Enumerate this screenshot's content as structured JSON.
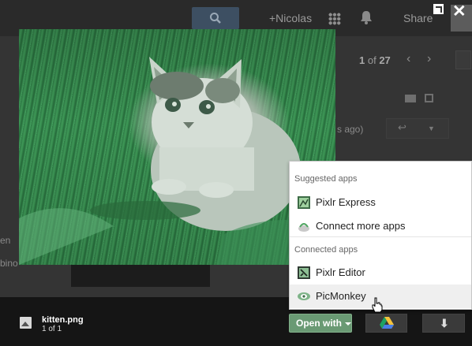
{
  "header": {
    "user_name": "+Nicolas",
    "share_label": "Share"
  },
  "pager": {
    "current": "1",
    "of_label": "of",
    "total": "27"
  },
  "message": {
    "time_fragment": "s ago)"
  },
  "sidebar_fragments": [
    "en",
    "bino"
  ],
  "viewer": {
    "close_glyph": "✕",
    "file_name": "kitten.png",
    "file_count": "1 of 1",
    "open_with_label": "Open with",
    "download_glyph": "⬇"
  },
  "open_with_menu": {
    "suggested_heading": "Suggested apps",
    "suggested": [
      {
        "label": "Pixlr Express",
        "icon": "pixlr-express-icon"
      },
      {
        "label": "Connect more apps",
        "icon": "connect-apps-icon"
      }
    ],
    "connected_heading": "Connected apps",
    "connected": [
      {
        "label": "Pixlr Editor",
        "icon": "pixlr-editor-icon"
      },
      {
        "label": "PicMonkey",
        "icon": "picmonkey-icon",
        "hovered": true
      }
    ]
  },
  "colors": {
    "open_with_green": "#6a9a74",
    "overlay_bg": "#343434",
    "bottom_bar": "#151515"
  }
}
